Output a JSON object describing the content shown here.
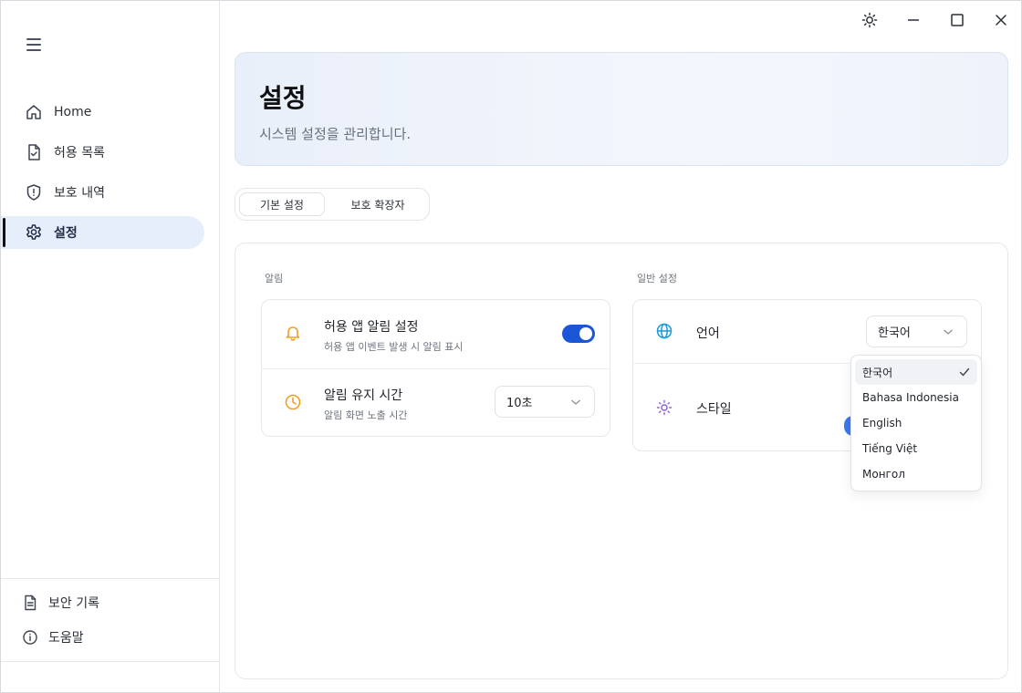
{
  "sidebar": {
    "items": [
      {
        "label": "Home",
        "icon": "home-icon"
      },
      {
        "label": "허용 목록",
        "icon": "file-check-icon"
      },
      {
        "label": "보호 내역",
        "icon": "shield-alert-icon"
      },
      {
        "label": "설정",
        "icon": "gear-icon",
        "active": true
      }
    ],
    "footer": [
      {
        "label": "보안 기록",
        "icon": "document-icon"
      },
      {
        "label": "도움말",
        "icon": "info-icon"
      }
    ]
  },
  "header": {
    "title": "설정",
    "subtitle": "시스템 설정을 관리합니다."
  },
  "tabs": [
    {
      "label": "기본 설정",
      "active": true
    },
    {
      "label": "보호 확장자"
    }
  ],
  "notifications": {
    "section_label": "알림",
    "rows": [
      {
        "title": "허용 앱 알림 설정",
        "desc": "허용 앱 이벤트 발생 시 알림 표시",
        "icon": "bell-icon",
        "toggle": true
      },
      {
        "title": "알림 유지 시간",
        "desc": "알림 화면 노출 시간",
        "icon": "clock-icon",
        "select_value": "10초"
      }
    ]
  },
  "general": {
    "section_label": "일반 설정",
    "rows": [
      {
        "title": "언어",
        "icon": "globe-icon",
        "select_value": "한국어"
      },
      {
        "title": "스타일",
        "icon": "sun-icon"
      }
    ]
  },
  "language_dropdown": {
    "options": [
      "한국어",
      "Bahasa Indonesia",
      "English",
      "Tiếng Việt",
      "Монгол"
    ],
    "selected": "한국어"
  },
  "colors": {
    "accent": "#1a56d6",
    "active_nav_bg": "#e6edfb",
    "bell": "#f0a020",
    "globe": "#1a9ad6",
    "sun": "#8a5cd6"
  }
}
